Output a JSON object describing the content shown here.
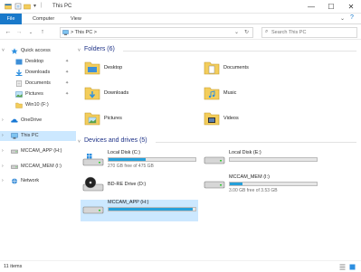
{
  "window": {
    "title": "This PC",
    "minimize_glyph": "—",
    "maximize_glyph": "☐",
    "close_glyph": "✕"
  },
  "ribbon": {
    "tabs": [
      {
        "label": "File"
      },
      {
        "label": "Computer"
      },
      {
        "label": "View"
      }
    ]
  },
  "address": {
    "path": "> This PC >",
    "search_placeholder": "Search This PC"
  },
  "sidebar": {
    "items": [
      {
        "label": "Quick access",
        "icon": "star-icon"
      },
      {
        "label": "Desktop",
        "icon": "desktop-icon",
        "pinned": true
      },
      {
        "label": "Downloads",
        "icon": "download-icon",
        "pinned": true
      },
      {
        "label": "Documents",
        "icon": "documents-icon",
        "pinned": true
      },
      {
        "label": "Pictures",
        "icon": "pictures-icon",
        "pinned": true
      },
      {
        "label": "Win10 (F:)",
        "icon": "folder-icon"
      },
      {
        "label": "OneDrive",
        "icon": "onedrive-icon"
      },
      {
        "label": "This PC",
        "icon": "computer-icon",
        "selected": true
      },
      {
        "label": "MCCAM_APP (H:)",
        "icon": "drive-icon"
      },
      {
        "label": "MCCAM_MEM (I:)",
        "icon": "drive-icon"
      },
      {
        "label": "Network",
        "icon": "network-icon"
      }
    ]
  },
  "folders": {
    "header": "Folders (6)",
    "items": [
      {
        "label": "Desktop",
        "icon": "desktop-folder-icon"
      },
      {
        "label": "Documents",
        "icon": "documents-folder-icon"
      },
      {
        "label": "Downloads",
        "icon": "downloads-folder-icon"
      },
      {
        "label": "Music",
        "icon": "music-folder-icon"
      },
      {
        "label": "Pictures",
        "icon": "pictures-folder-icon"
      },
      {
        "label": "Videos",
        "icon": "videos-folder-icon"
      }
    ]
  },
  "drives": {
    "header": "Devices and drives (5)",
    "items": [
      {
        "label": "Local Disk (C:)",
        "free": "270 GB free of 475 GB",
        "used_fraction": 0.43,
        "icon": "windows-drive-icon"
      },
      {
        "label": "Local Disk (E:)",
        "free": "",
        "used_fraction": 0.0,
        "icon": "hard-drive-icon"
      },
      {
        "label": "BD-RE Drive (D:)",
        "free": "",
        "used_fraction": null,
        "icon": "optical-drive-icon"
      },
      {
        "label": "MCCAM_MEM (I:)",
        "free": "3.00 GB free of 3.53 GB",
        "used_fraction": 0.15,
        "icon": "usb-drive-icon"
      },
      {
        "label": "MCCAM_APP (H:)",
        "free": "",
        "used_fraction": 0.97,
        "icon": "usb-drive-icon",
        "selected": true
      }
    ]
  },
  "status": {
    "text": "11 items"
  },
  "colors": {
    "accent": "#1979ca",
    "selection": "#cce8ff",
    "bar_fill": "#26a0da",
    "group_header": "#1e3287"
  }
}
